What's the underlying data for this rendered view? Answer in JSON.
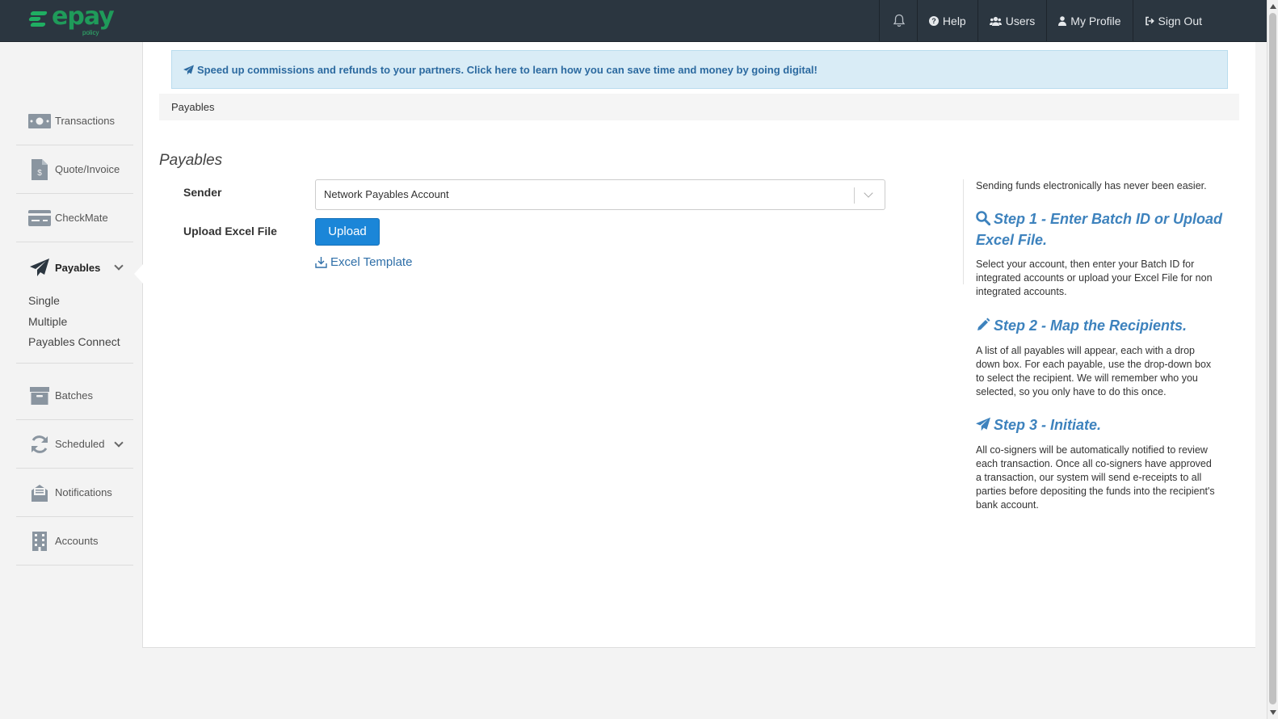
{
  "brand": {
    "name": "epay",
    "sub": "policy"
  },
  "topnav": {
    "help": "Help",
    "users": "Users",
    "profile": "My Profile",
    "signout": "Sign Out"
  },
  "sidebar": {
    "items": [
      {
        "label": "Transactions",
        "icon": "money-icon"
      },
      {
        "label": "Quote/Invoice",
        "icon": "invoice-icon"
      },
      {
        "label": "CheckMate",
        "icon": "check-card-icon"
      },
      {
        "label": "Payables",
        "icon": "paper-plane-icon"
      },
      {
        "label": "Batches",
        "icon": "archive-icon"
      },
      {
        "label": "Scheduled",
        "icon": "refresh-icon"
      },
      {
        "label": "Notifications",
        "icon": "envelope-icon"
      },
      {
        "label": "Accounts",
        "icon": "building-icon"
      }
    ],
    "payables_sub": [
      "Single",
      "Multiple",
      "Payables Connect"
    ]
  },
  "banner": {
    "text": "Speed up commissions and refunds to your partners. Click here to learn how you can save time and money by going digital!"
  },
  "breadcrumb": "Payables",
  "page": {
    "title": "Payables",
    "sender_label": "Sender",
    "sender_value": "Network Payables Account",
    "upload_label": "Upload Excel File",
    "upload_button": "Upload",
    "template_link": "Excel Template"
  },
  "help": {
    "intro": "Sending funds electronically has never been easier.",
    "step1_title": "Step 1 - Enter Batch ID or Upload Excel File.",
    "step1_text": "Select your account, then enter your Batch ID for integrated accounts or upload your Excel File for non integrated accounts.",
    "step2_title": "Step 2 - Map the Recipients.",
    "step2_text": "A list of all payables will appear, each with a drop down box. For each payable, use the drop-down box to select the recipient. We will remember who you selected, so you only have to do this once.",
    "step3_title": "Step 3 - Initiate.",
    "step3_text": "All co-signers will be automatically notified to review each transaction. Once all co-signers have approved a transaction, our system will send e-receipts to all parties before depositing the funds into the recipient's bank account."
  },
  "colors": {
    "topbar": "#2b3640",
    "accent": "#1b86d8",
    "brand_green": "#1f9b5a",
    "link": "#3d82bd"
  }
}
